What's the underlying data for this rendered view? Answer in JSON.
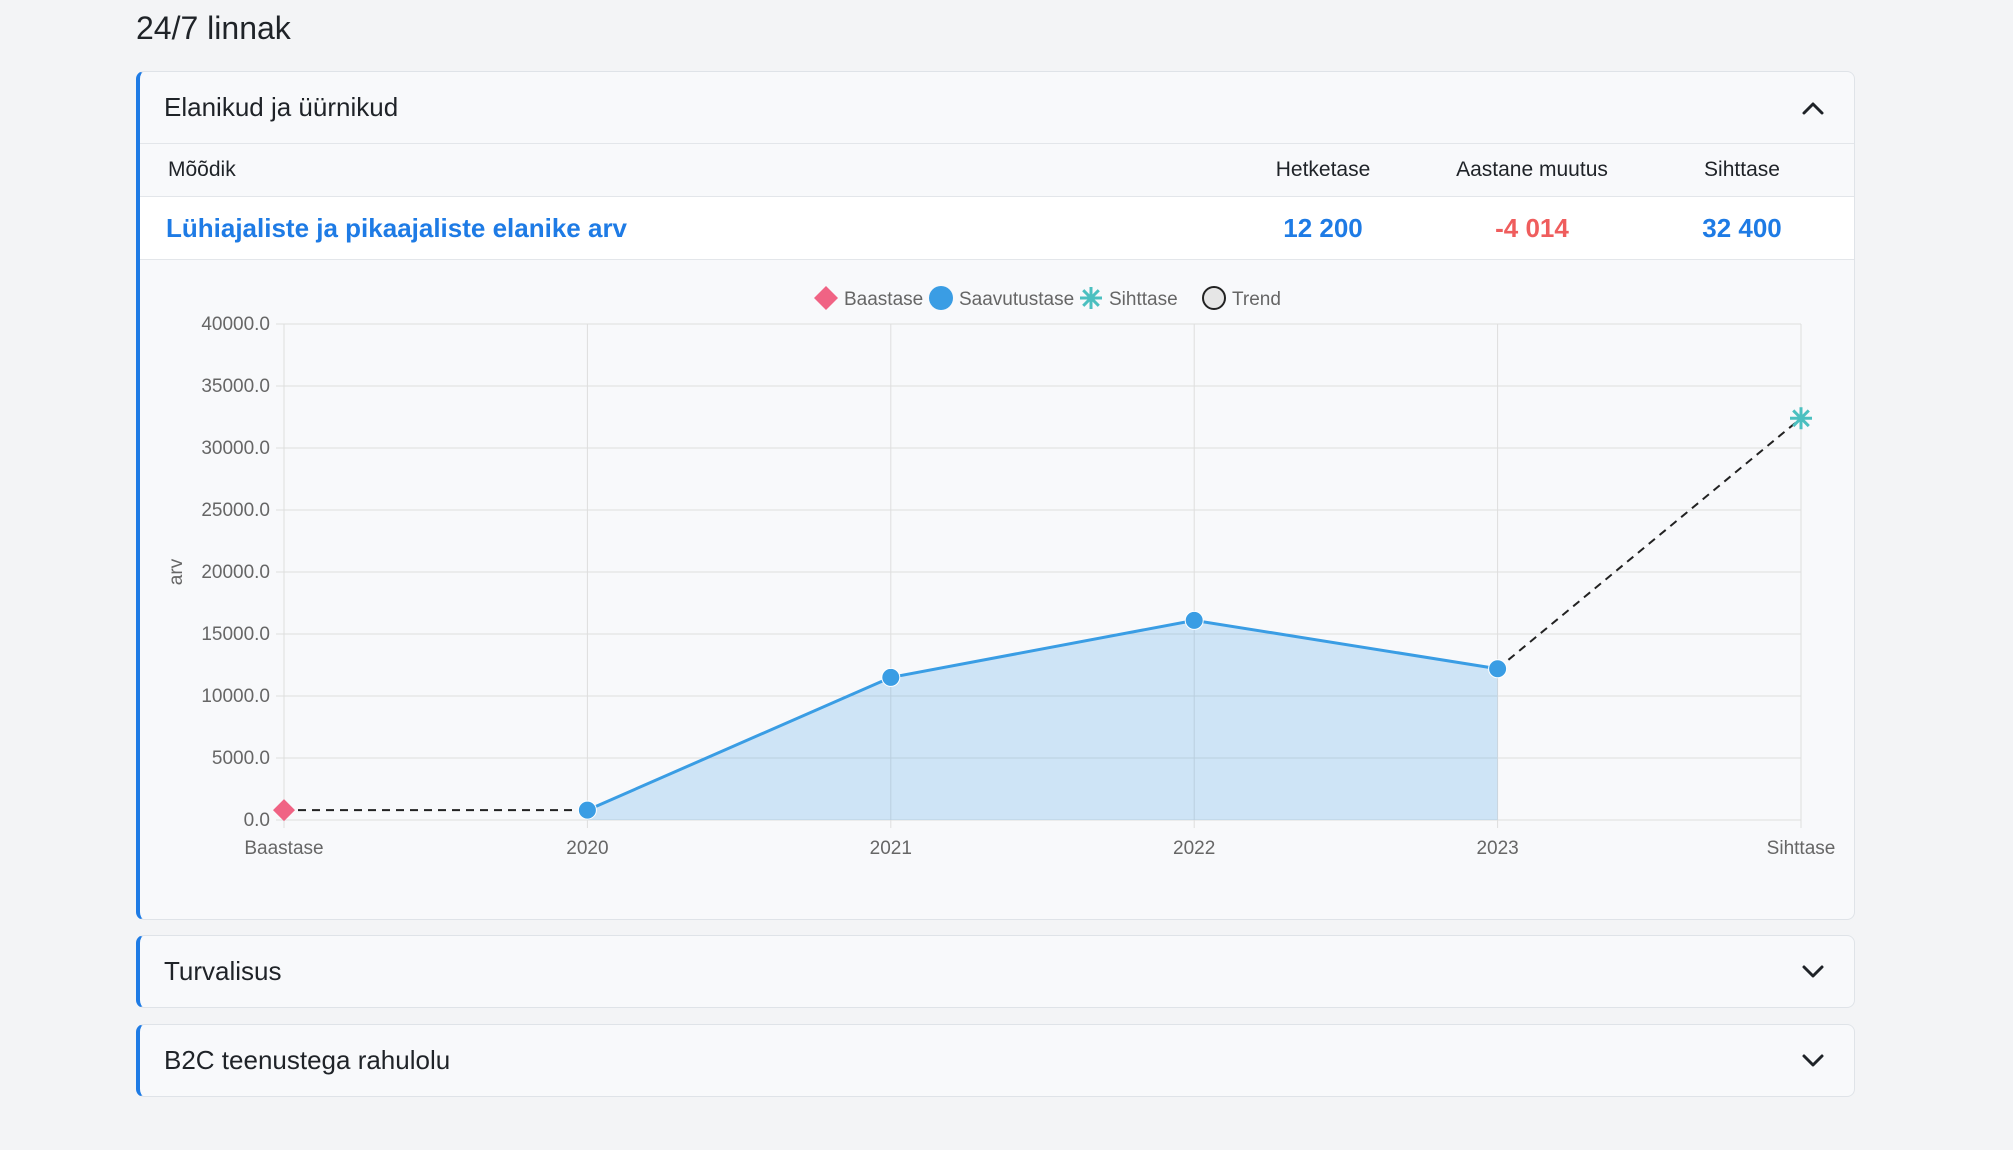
{
  "page": {
    "title": "24/7 linnak"
  },
  "sections": [
    {
      "title": "Elanikud ja üürnikud",
      "expanded": true
    },
    {
      "title": "Turvalisus",
      "expanded": false
    },
    {
      "title": "B2C teenustega rahulolu",
      "expanded": false
    }
  ],
  "table": {
    "headers": {
      "metric": "Mõõdik",
      "current": "Hetketase",
      "annual_change": "Aastane muutus",
      "target": "Sihttase"
    },
    "rows": [
      {
        "metric": "Lühiajaliste ja pikaajaliste elanike arv",
        "current": "12 200",
        "annual_change": "-4 014",
        "target": "32 400"
      }
    ]
  },
  "colors": {
    "accent": "#1e7be5",
    "negative": "#ef5d5d",
    "baseline": "#f06384",
    "achieved": "#3a9de4",
    "target": "#4bc0c0",
    "trend": "#222222"
  },
  "icons": {
    "collapse": "chevron-up-icon",
    "expand": "chevron-down-icon"
  },
  "chart_data": {
    "type": "line",
    "ylabel": "arv",
    "categories": [
      "Baastase",
      "2020",
      "2021",
      "2022",
      "2023",
      "Sihttase"
    ],
    "y_ticks": [
      "0.0",
      "5000.0",
      "10000.0",
      "15000.0",
      "20000.0",
      "25000.0",
      "30000.0",
      "35000.0",
      "40000.0"
    ],
    "ylim": [
      0,
      40000
    ],
    "grid": true,
    "legend_position": "top",
    "legend": [
      {
        "name": "Baastase",
        "marker": "diamond"
      },
      {
        "name": "Saavutustase",
        "marker": "circle"
      },
      {
        "name": "Sihttase",
        "marker": "star"
      },
      {
        "name": "Trend",
        "marker": "hollow-circle"
      }
    ],
    "series": [
      {
        "name": "Baastase",
        "points": [
          {
            "x": "Baastase",
            "y": 800
          }
        ]
      },
      {
        "name": "Saavutustase",
        "fill": true,
        "points": [
          {
            "x": "2020",
            "y": 800
          },
          {
            "x": "2021",
            "y": 11500
          },
          {
            "x": "2022",
            "y": 16100
          },
          {
            "x": "2023",
            "y": 12200
          }
        ]
      },
      {
        "name": "Sihttase",
        "points": [
          {
            "x": "Sihttase",
            "y": 32400
          }
        ]
      },
      {
        "name": "Trend",
        "dashed": true,
        "points": [
          {
            "x": "Baastase",
            "y": 800
          },
          {
            "x": "2020",
            "y": 800
          },
          {
            "x": "2023",
            "y": 12200
          },
          {
            "x": "Sihttase",
            "y": 32400
          }
        ]
      }
    ]
  }
}
